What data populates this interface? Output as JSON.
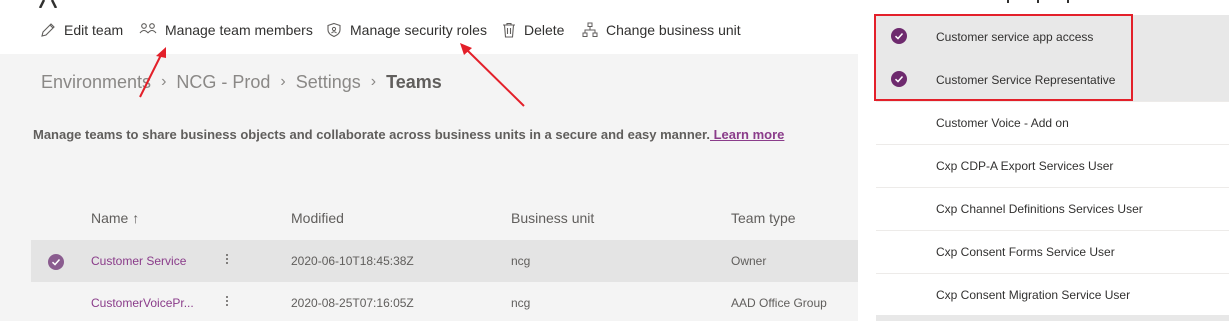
{
  "toolbar": {
    "edit_team": "Edit team",
    "manage_members": "Manage team members",
    "manage_roles": "Manage security roles",
    "delete": "Delete",
    "change_bu": "Change business unit"
  },
  "breadcrumb": [
    "Environments",
    "NCG - Prod",
    "Settings",
    "Teams"
  ],
  "description": {
    "text": "Manage teams to share business objects and collaborate across business units in a secure and easy manner.",
    "link": " Learn more"
  },
  "grid": {
    "columns": {
      "name": "Name ↑",
      "modified": "Modified",
      "business_unit": "Business unit",
      "team_type": "Team type"
    },
    "rows": [
      {
        "name": "Customer Service",
        "modified": "2020-06-10T18:45:38Z",
        "business_unit": "ncg",
        "team_type": "Owner",
        "selected": true
      },
      {
        "name": "CustomerVoicePr...",
        "modified": "2020-08-25T07:16:05Z",
        "business_unit": "ncg",
        "team_type": "AAD Office Group",
        "selected": false
      }
    ]
  },
  "roles_panel": {
    "items": [
      {
        "label": "Customer service app access",
        "selected": true
      },
      {
        "label": "Customer Service Representative",
        "selected": true
      },
      {
        "label": "Customer Voice - Add on",
        "selected": false
      },
      {
        "label": "Cxp CDP-A Export Services User",
        "selected": false
      },
      {
        "label": "Cxp Channel Definitions Services User",
        "selected": false
      },
      {
        "label": "Cxp Consent Forms Service User",
        "selected": false
      },
      {
        "label": "Cxp Consent Migration Service User",
        "selected": false
      }
    ]
  },
  "colors": {
    "accent": "#8a3c8a",
    "check": "#6e2a6e",
    "annotation": "#e3202a"
  }
}
